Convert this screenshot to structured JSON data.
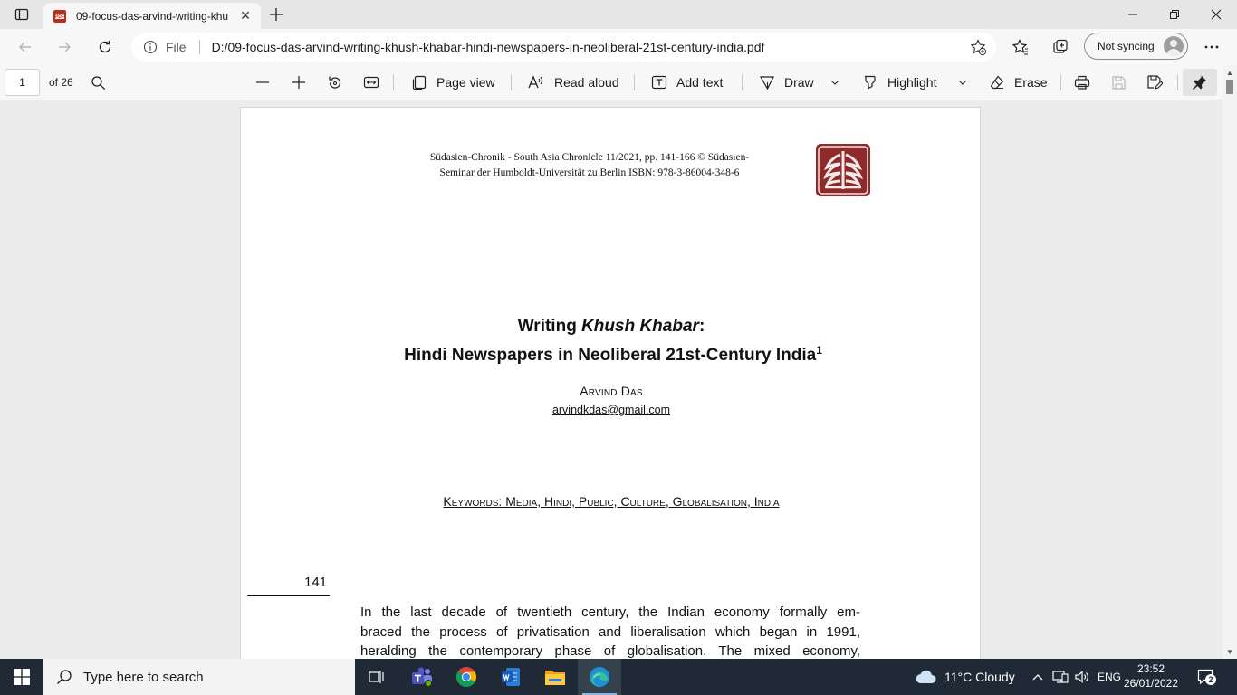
{
  "browser": {
    "tab_title": "09-focus-das-arvind-writing-khu",
    "tab_favicon": "pdf-icon",
    "address": {
      "scheme": "File",
      "url": "D:/09-focus-das-arvind-writing-khush-khabar-hindi-newspapers-in-neoliberal-21st-century-india.pdf"
    },
    "profile_label": "Not syncing"
  },
  "pdf_toolbar": {
    "page_current": "1",
    "page_total_label": "of 26",
    "page_view_label": "Page view",
    "read_aloud_label": "Read aloud",
    "add_text_label": "Add text",
    "draw_label": "Draw",
    "highlight_label": "Highlight",
    "erase_label": "Erase"
  },
  "document": {
    "header_line1": "Südasien-Chronik - South Asia Chronicle 11/2021, pp. 141-166 © Südasien-",
    "header_line2": "Seminar der Humboldt-Universität zu Berlin ISBN: 978-3-86004-348-6",
    "title_part1": "Writing ",
    "title_italic": "Khush Khabar",
    "title_part2": ":",
    "title_line2": "Hindi Newspapers in Neoliberal 21st-Century India",
    "title_footnote": "1",
    "author": "Arvind Das",
    "email": "arvindkdas@gmail.com",
    "keywords": "Keywords: Media, Hindi, Public, Culture, Globalisation, India",
    "page_number": "141",
    "body_lines": [
      "In the last decade of twentieth century, the Indian economy formally em-",
      "braced the process of privatisation and liberalisation which began in 1991,",
      "heralding the contemporary phase of globalisation. The mixed economy,"
    ]
  },
  "taskbar": {
    "search_placeholder": "Type here to search",
    "weather": "11°C  Cloudy",
    "language": "ENG",
    "time": "23:52",
    "date": "26/01/2022",
    "notification_count": "2"
  },
  "colors": {
    "seal": "#8e2a2a",
    "taskbar": "#1f2a36",
    "tab_active": "#f7f7f7",
    "tabstrip": "#e6e6e6"
  }
}
